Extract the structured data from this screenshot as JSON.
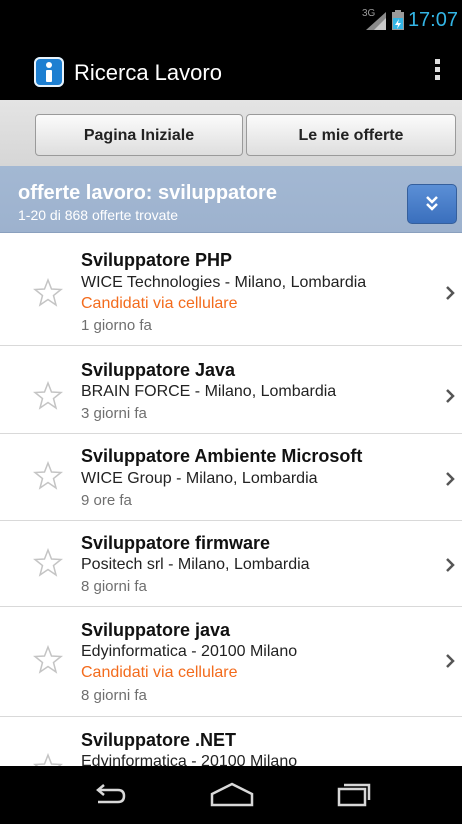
{
  "status_bar": {
    "network": "3G",
    "time": "17:07"
  },
  "app_bar": {
    "title": "Ricerca Lavoro",
    "app_icon": "info-icon",
    "menu_icon": "overflow-menu-icon"
  },
  "tabs": {
    "home_label": "Pagina Iniziale",
    "my_offers_label": "Le mie offerte"
  },
  "search": {
    "title": "offerte lavoro: sviluppatore",
    "count": "1-20 di 868 offerte trovate",
    "expand_icon": "double-chevron-down-icon"
  },
  "jobs": [
    {
      "title": "Sviluppatore PHP",
      "company": "WICE Technologies -  Milano, Lombardia",
      "mobile": "Candidati via cellulare",
      "time": "1 giorno fa"
    },
    {
      "title": "Sviluppatore Java",
      "company": "BRAIN FORCE -  Milano, Lombardia",
      "mobile": "",
      "time": "3 giorni fa"
    },
    {
      "title": "Sviluppatore Ambiente Microsoft",
      "company": "WICE Group -  Milano, Lombardia",
      "mobile": "",
      "time": "9 ore fa"
    },
    {
      "title": "Sviluppatore firmware",
      "company": "Positech srl -  Milano, Lombardia",
      "mobile": "",
      "time": "8 giorni fa"
    },
    {
      "title": "Sviluppatore java",
      "company": "Edyinformatica -  20100 Milano",
      "mobile": "Candidati via cellulare",
      "time": "8 giorni fa"
    },
    {
      "title": "Sviluppatore .NET",
      "company": "Edyinformatica -  20100 Milano",
      "mobile": "",
      "time": ""
    }
  ],
  "nav_bar": {
    "back_icon": "back-icon",
    "home_icon": "home-icon",
    "recents_icon": "recent-apps-icon"
  },
  "colors": {
    "accent_time": "#33b5e5",
    "mobile_apply": "#f36b1c",
    "header_bg": "#a3b8d3",
    "expand_button": "#3a6fbd"
  }
}
